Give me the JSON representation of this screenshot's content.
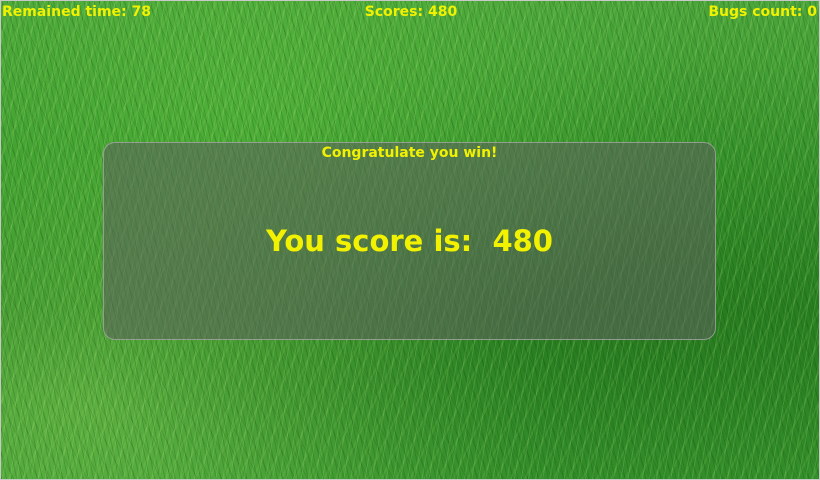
{
  "hud": {
    "remained_time_label": "Remained time:",
    "remained_time_value": "78",
    "scores_label": "Scores:",
    "scores_value": "480",
    "bugs_count_label": "Bugs count:",
    "bugs_count_value": "0"
  },
  "dialog": {
    "title": "Congratulate you win!",
    "score_label": "You score is: ",
    "score_value": "480"
  },
  "colors": {
    "text": "#f2f200",
    "background": "grass-green"
  }
}
